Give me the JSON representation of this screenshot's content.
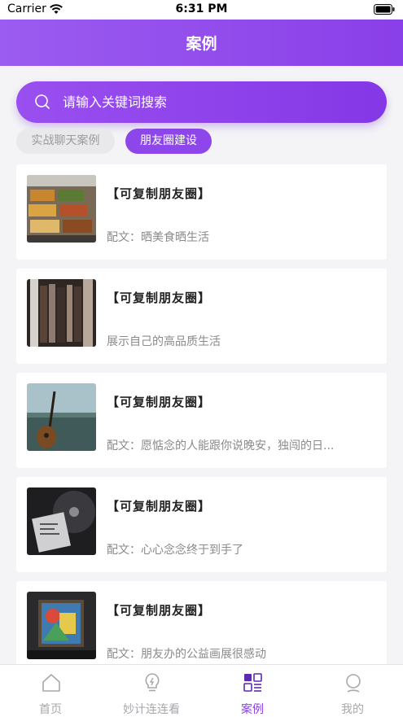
{
  "status_bar": {
    "carrier": "Carrier",
    "time": "6:31 PM"
  },
  "header": {
    "title": "案例"
  },
  "search": {
    "placeholder": "请输入关键词搜索"
  },
  "categories": [
    {
      "label": "实战聊天案例",
      "active": false
    },
    {
      "label": "朋友圈建设",
      "active": true
    }
  ],
  "cases": [
    {
      "title": "【可复制朋友圈】",
      "desc": "配文：晒美食晒生活"
    },
    {
      "title": "【可复制朋友圈】",
      "desc": "展示自己的高品质生活"
    },
    {
      "title": "【可复制朋友圈】",
      "desc": "配文：愿惦念的人能跟你说晚安，独闯的日..."
    },
    {
      "title": "【可复制朋友圈】",
      "desc": "配文：心心念念终于到手了"
    },
    {
      "title": "【可复制朋友圈】",
      "desc": "配文：朋友办的公益画展很感动"
    }
  ],
  "tabs": [
    {
      "label": "首页",
      "icon": "home-icon",
      "active": false
    },
    {
      "label": "妙计连连看",
      "icon": "lightbulb-icon",
      "active": false
    },
    {
      "label": "案例",
      "icon": "cases-icon",
      "active": true
    },
    {
      "label": "我的",
      "icon": "profile-icon",
      "active": false
    }
  ],
  "colors": {
    "accent": "#8a3fe8",
    "inactive": "#a8a8ac",
    "background": "#f4f4f6"
  }
}
